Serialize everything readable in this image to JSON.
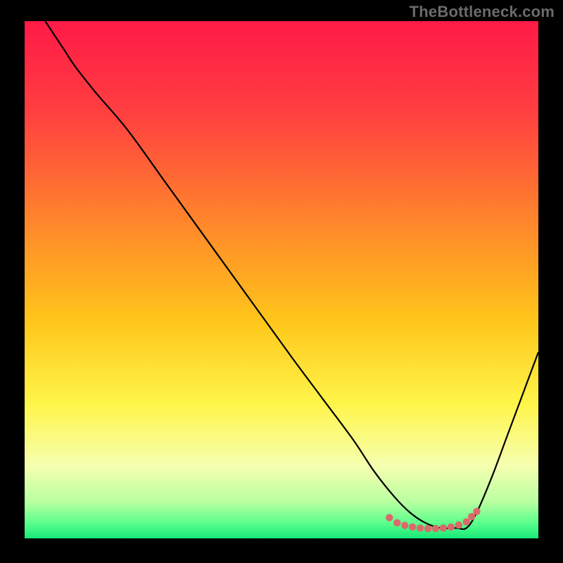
{
  "watermark": "TheBottleneck.com",
  "chart_data": {
    "type": "line",
    "title": "",
    "xlabel": "",
    "ylabel": "",
    "xlim": [
      0,
      100
    ],
    "ylim": [
      0,
      100
    ],
    "background_gradient_stops": [
      {
        "offset": 0.0,
        "color": "#ff1a47"
      },
      {
        "offset": 0.18,
        "color": "#ff4040"
      },
      {
        "offset": 0.4,
        "color": "#ff8a2a"
      },
      {
        "offset": 0.58,
        "color": "#ffc61a"
      },
      {
        "offset": 0.74,
        "color": "#fff54a"
      },
      {
        "offset": 0.86,
        "color": "#f6ffb0"
      },
      {
        "offset": 0.93,
        "color": "#b8ffa0"
      },
      {
        "offset": 0.97,
        "color": "#5cff8c"
      },
      {
        "offset": 1.0,
        "color": "#17e879"
      }
    ],
    "series": [
      {
        "name": "bottleneck-curve",
        "color": "#000000",
        "x": [
          4,
          6,
          8,
          10,
          14,
          20,
          28,
          36,
          44,
          52,
          58,
          64,
          68,
          72,
          75,
          78,
          81,
          84,
          86,
          88,
          91,
          94,
          97,
          100
        ],
        "y": [
          100,
          97,
          94,
          91,
          86,
          79,
          68,
          57,
          46,
          35,
          27,
          19,
          13,
          8,
          5,
          3,
          2,
          2,
          2,
          5,
          12,
          20,
          28,
          36
        ]
      },
      {
        "name": "optimal-region",
        "color": "#d96a6a",
        "x": [
          71,
          72.5,
          74,
          75.5,
          77,
          78.5,
          80,
          81.5,
          83,
          84.5,
          86,
          87,
          88
        ],
        "y": [
          4.0,
          3.0,
          2.5,
          2.2,
          2.0,
          1.9,
          1.9,
          2.0,
          2.2,
          2.6,
          3.2,
          4.2,
          5.2
        ]
      }
    ]
  }
}
